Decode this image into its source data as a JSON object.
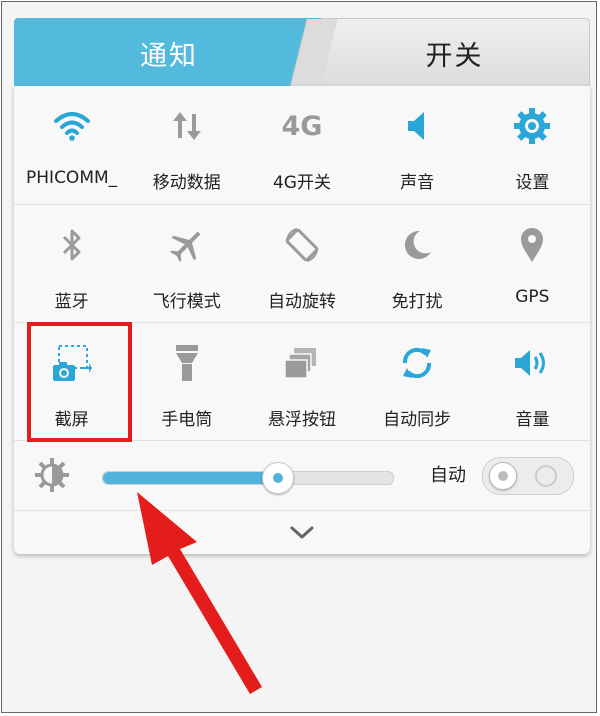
{
  "tabs": {
    "notify": "通知",
    "switch": "开关"
  },
  "rows": [
    [
      {
        "label": "PHICOMM_",
        "icon": "wifi-icon"
      },
      {
        "label": "移动数据",
        "icon": "mobile-data-icon"
      },
      {
        "label": "4G开关",
        "icon": "4g-icon"
      },
      {
        "label": "声音",
        "icon": "sound-icon"
      },
      {
        "label": "设置",
        "icon": "settings-icon"
      }
    ],
    [
      {
        "label": "蓝牙",
        "icon": "bluetooth-icon"
      },
      {
        "label": "飞行模式",
        "icon": "airplane-icon"
      },
      {
        "label": "自动旋转",
        "icon": "rotate-icon"
      },
      {
        "label": "免打扰",
        "icon": "moon-icon"
      },
      {
        "label": "GPS",
        "icon": "gps-icon"
      }
    ],
    [
      {
        "label": "截屏",
        "icon": "screenshot-icon"
      },
      {
        "label": "手电筒",
        "icon": "flashlight-icon"
      },
      {
        "label": "悬浮按钮",
        "icon": "floating-button-icon"
      },
      {
        "label": "自动同步",
        "icon": "sync-icon"
      },
      {
        "label": "音量",
        "icon": "volume-icon"
      }
    ]
  ],
  "icon4g": "4G",
  "brightness": {
    "level": 0.6,
    "auto_label": "自动",
    "auto_on": false
  },
  "colors": {
    "accent": "#4fb3dc",
    "highlight": "#e41c1c",
    "icon_gray": "#9a9a9a"
  }
}
